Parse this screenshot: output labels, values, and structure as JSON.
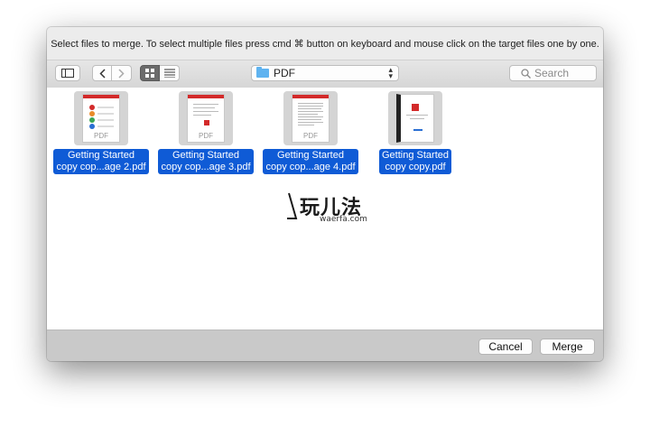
{
  "dialog": {
    "prompt": "Select files to merge. To select multiple files press cmd ⌘ button on keyboard and mouse click on the target files one by one."
  },
  "toolbar": {
    "back_icon": "chevron-left-icon",
    "forward_icon": "chevron-right-icon",
    "sidebar_icon": "sidebar-icon",
    "icon_view_icon": "grid-icon",
    "list_view_icon": "list-icon",
    "location": "PDF",
    "search_placeholder": "Search"
  },
  "files": [
    {
      "name_line1": "Getting Started",
      "name_line2": "copy cop...age 2.pdf",
      "selected": true
    },
    {
      "name_line1": "Getting Started",
      "name_line2": "copy cop...age 3.pdf",
      "selected": true
    },
    {
      "name_line1": "Getting Started",
      "name_line2": "copy cop...age 4.pdf",
      "selected": true
    },
    {
      "name_line1": "Getting Started",
      "name_line2": "copy copy.pdf",
      "selected": true
    }
  ],
  "thumb_pdf_tag": "PDF",
  "watermark": {
    "text": "玩儿法",
    "sub": "waerfa.com"
  },
  "footer": {
    "cancel_label": "Cancel",
    "merge_label": "Merge"
  },
  "colors": {
    "selection": "#0f5bd6",
    "folder": "#5fb3f0",
    "pdf_red": "#d32a2a"
  }
}
